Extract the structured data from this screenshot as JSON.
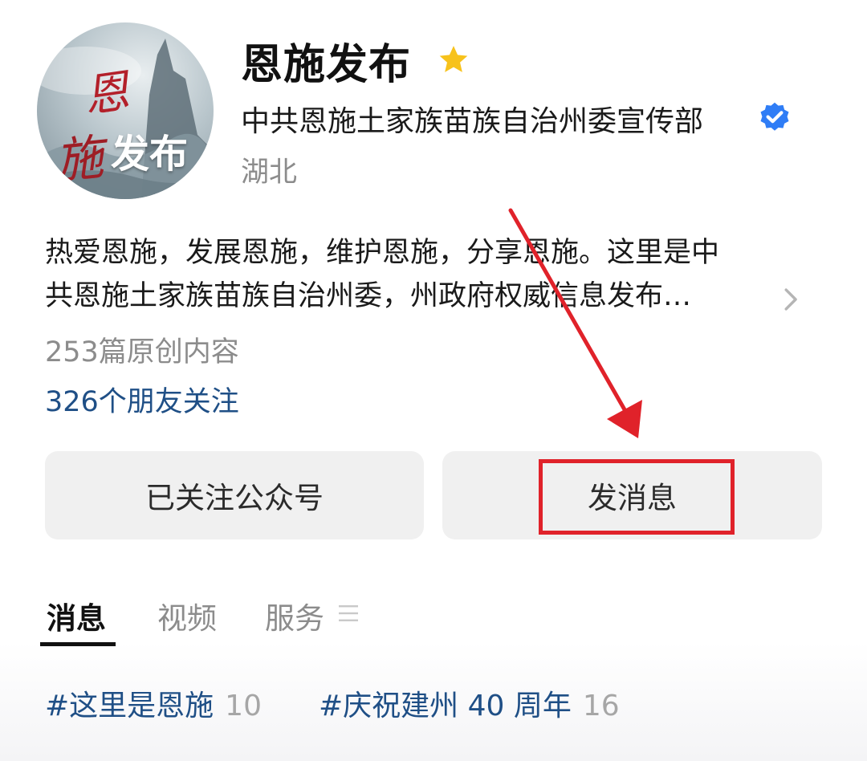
{
  "profile": {
    "name": "恩施发布",
    "organization": "中共恩施土家族苗族自治州委宣传部",
    "region": "湖北",
    "avatar_text": {
      "line1": "恩",
      "line2": "施",
      "line3": "发布"
    },
    "star_icon": "star-icon",
    "verified_icon": "verified-check-icon",
    "star_color": "#f7c21b",
    "verified_color": "#2f7df6"
  },
  "description": {
    "line1": "热爱恩施，发展恩施，维护恩施，分享恩施。这里是中",
    "line2": "共恩施土家族苗族自治州委，州政府权威信息发布…"
  },
  "stats": {
    "original_content": "253篇原创内容",
    "friends_following": "326个朋友关注"
  },
  "actions": {
    "followed_label": "已关注公众号",
    "message_label": "发消息"
  },
  "annotation": {
    "highlight_color": "#e0222a"
  },
  "tabs": [
    {
      "label": "消息",
      "active": true
    },
    {
      "label": "视频",
      "active": false
    },
    {
      "label": "服务",
      "active": false
    }
  ],
  "hashtags": [
    {
      "label": "#这里是恩施",
      "count": "10"
    },
    {
      "label": "#庆祝建州 40 周年",
      "count": "16"
    }
  ]
}
